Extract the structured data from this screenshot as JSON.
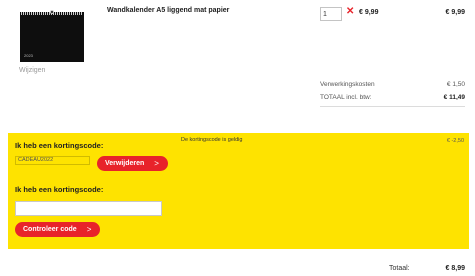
{
  "cart": {
    "item": {
      "thumbnail": {
        "icon": "wall-calendar-thumbnail",
        "year_text": "2023"
      },
      "name": "Wandkalender A5 liggend mat papier",
      "edit_label": "Wijzigen",
      "quantity": "1",
      "remove_icon": "close-x-icon",
      "unit_price": "€ 9,99",
      "line_total": "€ 9,99"
    },
    "costs": {
      "processing_label": "Verwerkingskosten",
      "processing_value": "€ 1,50",
      "total_incl_label": "TOTAAL incl. btw:",
      "total_incl_value": "€ 11,49"
    }
  },
  "discount": {
    "panel_color": "#fee300",
    "applied": {
      "heading": "Ik heb een kortingscode:",
      "code": "CADEAU2022",
      "valid_message": "De kortingscode is geldig",
      "amount": "€ -2,50",
      "remove_button": "Verwijderen"
    },
    "new": {
      "heading": "Ik heb een kortingscode:",
      "input_value": "",
      "check_button": "Controleer code"
    },
    "button_color": "#e8232a"
  },
  "grand_total": {
    "label": "Totaal:",
    "value": "€ 8,99"
  }
}
